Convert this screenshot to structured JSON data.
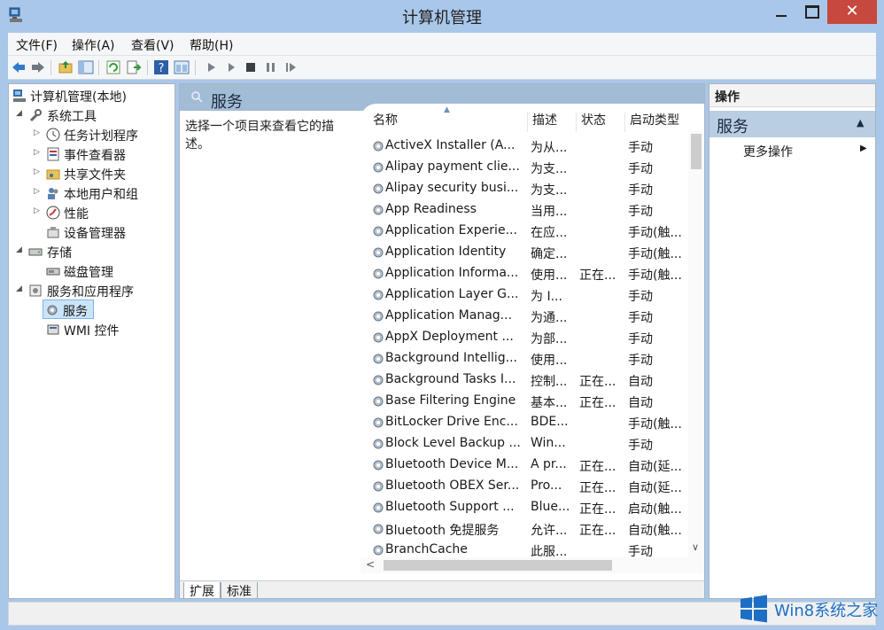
{
  "window": {
    "title": "计算机管理",
    "close_glyph": "✕"
  },
  "menu": [
    "文件(F)",
    "操作(A)",
    "查看(V)",
    "帮助(H)"
  ],
  "toolbar": {
    "icons": [
      "back-arrow-icon",
      "forward-arrow-icon",
      "up-folder-icon",
      "show-hide-tree-icon",
      "refresh-icon",
      "export-list-icon",
      "help-icon",
      "properties-icon",
      "start-icon",
      "start-service-icon",
      "stop-icon",
      "pause-icon",
      "restart-icon"
    ]
  },
  "tree": {
    "items": [
      {
        "label": "计算机管理(本地)",
        "icon": "computer-management-icon",
        "arrow": ""
      },
      {
        "label": "系统工具",
        "icon": "system-tools-icon",
        "arrow": "◢"
      },
      {
        "label": "任务计划程序",
        "icon": "task-scheduler-icon",
        "arrow": "▷"
      },
      {
        "label": "事件查看器",
        "icon": "event-viewer-icon",
        "arrow": "▷"
      },
      {
        "label": "共享文件夹",
        "icon": "shared-folders-icon",
        "arrow": "▷"
      },
      {
        "label": "本地用户和组",
        "icon": "local-users-icon",
        "arrow": "▷"
      },
      {
        "label": "性能",
        "icon": "performance-icon",
        "arrow": "▷"
      },
      {
        "label": "设备管理器",
        "icon": "device-manager-icon",
        "arrow": ""
      },
      {
        "label": "存储",
        "icon": "storage-icon",
        "arrow": "◢"
      },
      {
        "label": "磁盘管理",
        "icon": "disk-management-icon",
        "arrow": ""
      },
      {
        "label": "服务和应用程序",
        "icon": "services-apps-icon",
        "arrow": "◢"
      },
      {
        "label": "服务",
        "icon": "services-icon",
        "arrow": ""
      },
      {
        "label": "WMI 控件",
        "icon": "wmi-control-icon",
        "arrow": ""
      }
    ]
  },
  "center": {
    "title": "服务",
    "description": "选择一个项目来查看它的描述。",
    "columns": {
      "name": "名称",
      "desc": "描述",
      "status": "状态",
      "startup": "启动类型"
    },
    "services": [
      {
        "name": "ActiveX Installer (A...",
        "desc": "为从...",
        "status": "",
        "startup": "手动"
      },
      {
        "name": "Alipay payment clie...",
        "desc": "为支...",
        "status": "",
        "startup": "手动"
      },
      {
        "name": "Alipay security busi...",
        "desc": "为支...",
        "status": "",
        "startup": "手动"
      },
      {
        "name": "App Readiness",
        "desc": "当用...",
        "status": "",
        "startup": "手动"
      },
      {
        "name": "Application Experie...",
        "desc": "在应...",
        "status": "",
        "startup": "手动(触..."
      },
      {
        "name": "Application Identity",
        "desc": "确定...",
        "status": "",
        "startup": "手动(触..."
      },
      {
        "name": "Application Informa...",
        "desc": "使用...",
        "status": "正在...",
        "startup": "手动(触..."
      },
      {
        "name": "Application Layer G...",
        "desc": "为 I...",
        "status": "",
        "startup": "手动"
      },
      {
        "name": "Application Manag...",
        "desc": "为通...",
        "status": "",
        "startup": "手动"
      },
      {
        "name": "AppX Deployment ...",
        "desc": "为部...",
        "status": "",
        "startup": "手动"
      },
      {
        "name": "Background Intellig...",
        "desc": "使用...",
        "status": "",
        "startup": "手动"
      },
      {
        "name": "Background Tasks I...",
        "desc": "控制...",
        "status": "正在...",
        "startup": "自动"
      },
      {
        "name": "Base Filtering Engine",
        "desc": "基本...",
        "status": "正在...",
        "startup": "自动"
      },
      {
        "name": "BitLocker Drive Enc...",
        "desc": "BDE...",
        "status": "",
        "startup": "手动(触..."
      },
      {
        "name": "Block Level Backup ...",
        "desc": "Win...",
        "status": "",
        "startup": "手动"
      },
      {
        "name": "Bluetooth Device M...",
        "desc": "A pr...",
        "status": "正在...",
        "startup": "自动(延..."
      },
      {
        "name": "Bluetooth OBEX Ser...",
        "desc": "Pro...",
        "status": "正在...",
        "startup": "自动(延..."
      },
      {
        "name": "Bluetooth Support ...",
        "desc": "Blue...",
        "status": "正在...",
        "startup": "启动(触..."
      },
      {
        "name": "Bluetooth 免提服务",
        "desc": "允许...",
        "status": "正在...",
        "startup": "自动(触..."
      },
      {
        "name": "BranchCache",
        "desc": "此服...",
        "status": "",
        "startup": "手动"
      }
    ],
    "tabs": [
      "扩展",
      "标准"
    ]
  },
  "actions": {
    "header": "操作",
    "group": "服务",
    "more": "更多操作"
  },
  "watermark": {
    "text": "Win8系统之家"
  },
  "colors": {
    "title_bar": "#a9c7e8",
    "close_button": "#c7483f",
    "selection": "#cce4f7",
    "panel_band": "#a3bcd6",
    "watermark": "#1c6fc4"
  }
}
